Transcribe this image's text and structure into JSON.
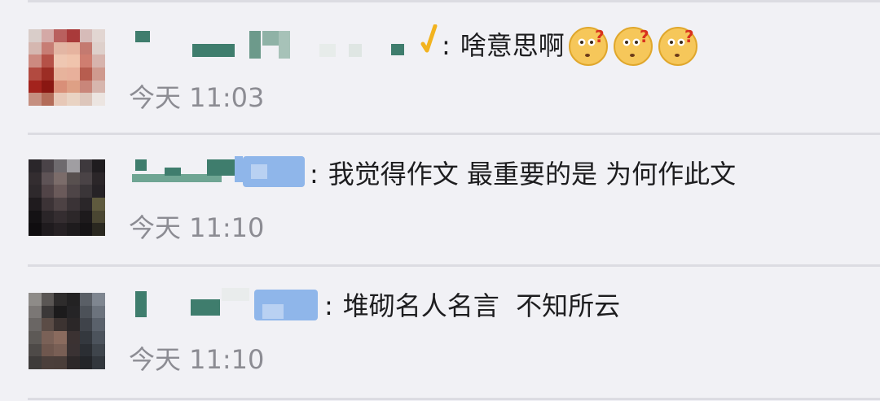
{
  "comments": [
    {
      "separator": ":",
      "text": "啥意思啊",
      "emoji": [
        "confused-face-emoji",
        "confused-face-emoji",
        "confused-face-emoji"
      ],
      "time": "今天 11:03"
    },
    {
      "separator": ":",
      "text": "我觉得作文 最重要的是 为何作此文",
      "time": "今天 11:10"
    },
    {
      "separator": ":",
      "text": "堆砌名人名言  不知所云",
      "time": "今天 11:10"
    }
  ],
  "colors": {
    "background": "#f1f1f5",
    "divider": "#dcdce2",
    "text": "#1d1d1f",
    "time": "#8c8c93",
    "blurred_name_green": "#3f7d6d",
    "blurred_name_blue": "#8fb6ea",
    "check_icon": "#f2b31f"
  }
}
